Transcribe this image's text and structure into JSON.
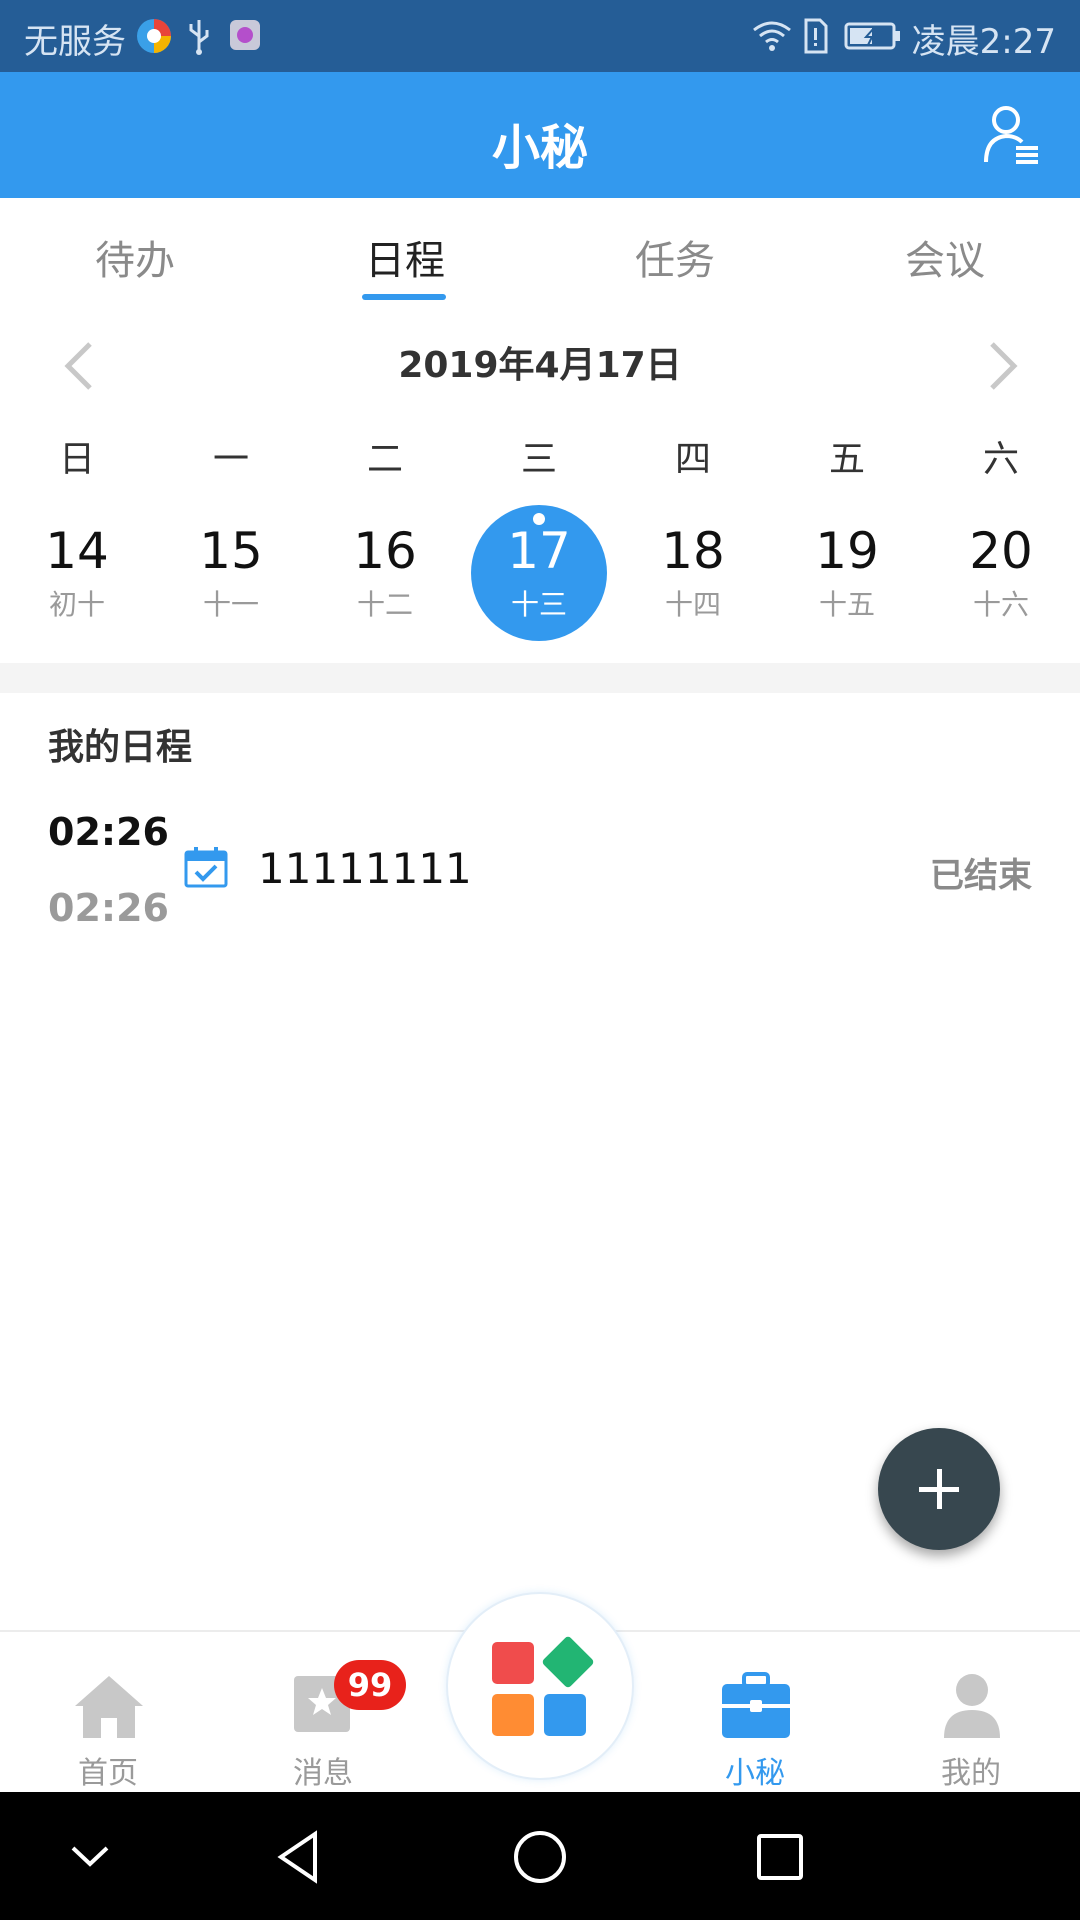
{
  "status_bar": {
    "carrier": "无服务",
    "time": "凌晨2:27"
  },
  "header": {
    "title": "小秘"
  },
  "tabs": [
    {
      "label": "待办",
      "active": false
    },
    {
      "label": "日程",
      "active": true
    },
    {
      "label": "任务",
      "active": false
    },
    {
      "label": "会议",
      "active": false
    }
  ],
  "calendar": {
    "month_label": "2019年4月17日",
    "weekdays": [
      "日",
      "一",
      "二",
      "三",
      "四",
      "五",
      "六"
    ],
    "days": [
      {
        "num": "14",
        "lunar": "初十"
      },
      {
        "num": "15",
        "lunar": "十一"
      },
      {
        "num": "16",
        "lunar": "十二"
      },
      {
        "num": "17",
        "lunar": "十三",
        "selected": true,
        "has_event": true
      },
      {
        "num": "18",
        "lunar": "十四"
      },
      {
        "num": "19",
        "lunar": "十五"
      },
      {
        "num": "20",
        "lunar": "十六"
      }
    ]
  },
  "schedule": {
    "section_title": "我的日程",
    "events": [
      {
        "start": "02:26",
        "end": "02:26",
        "title": "11111111",
        "status": "已结束"
      }
    ]
  },
  "bottom_nav": {
    "items": [
      {
        "label": "首页",
        "icon": "home-icon"
      },
      {
        "label": "消息",
        "icon": "message-icon",
        "badge": "99"
      },
      {
        "label": "小秘",
        "icon": "briefcase-icon",
        "active": true
      },
      {
        "label": "我的",
        "icon": "person-icon"
      }
    ],
    "center_icon": "apps-icon"
  },
  "colors": {
    "primary": "#3399ee",
    "status_bar": "#255d96",
    "fab": "#37474f",
    "badge": "#e8221b"
  }
}
